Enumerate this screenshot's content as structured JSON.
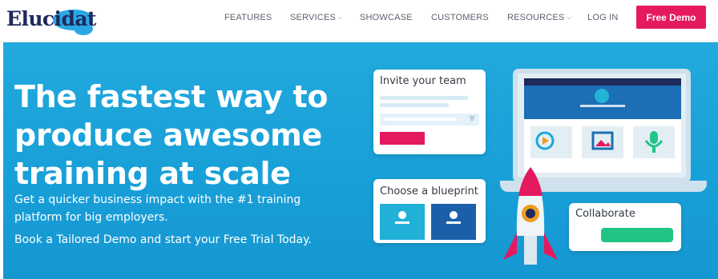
{
  "nav": {
    "logo_text": "Elucidat",
    "items": [
      {
        "label": "FEATURES",
        "dropdown": false
      },
      {
        "label": "SERVICES",
        "dropdown": true
      },
      {
        "label": "SHOWCASE",
        "dropdown": false
      },
      {
        "label": "CUSTOMERS",
        "dropdown": false
      },
      {
        "label": "RESOURCES",
        "dropdown": true
      },
      {
        "label": "LOG IN",
        "dropdown": false
      }
    ],
    "cta_label": "Free Demo"
  },
  "hero": {
    "headline_lines": [
      "The fastest way to",
      "produce awesome",
      "training at scale"
    ],
    "subtext": "Get a quicker business impact with the #1 training platform for big employers.",
    "subtext2": "Book a Tailored Demo and start your Free Trial Today."
  },
  "illustration": {
    "invite_card_title": "Invite your team",
    "blueprint_card_title": "Choose a blueprint",
    "collab_card_title": "Collaborate"
  },
  "colors": {
    "accent_pink": "#e5195e",
    "hero_blue": "#1aa3da",
    "navy": "#1d2a5c",
    "green": "#22c486"
  },
  "icons": [
    "chevron-down-icon",
    "play-icon",
    "image-icon",
    "microphone-icon",
    "rocket-icon",
    "person-icon"
  ]
}
